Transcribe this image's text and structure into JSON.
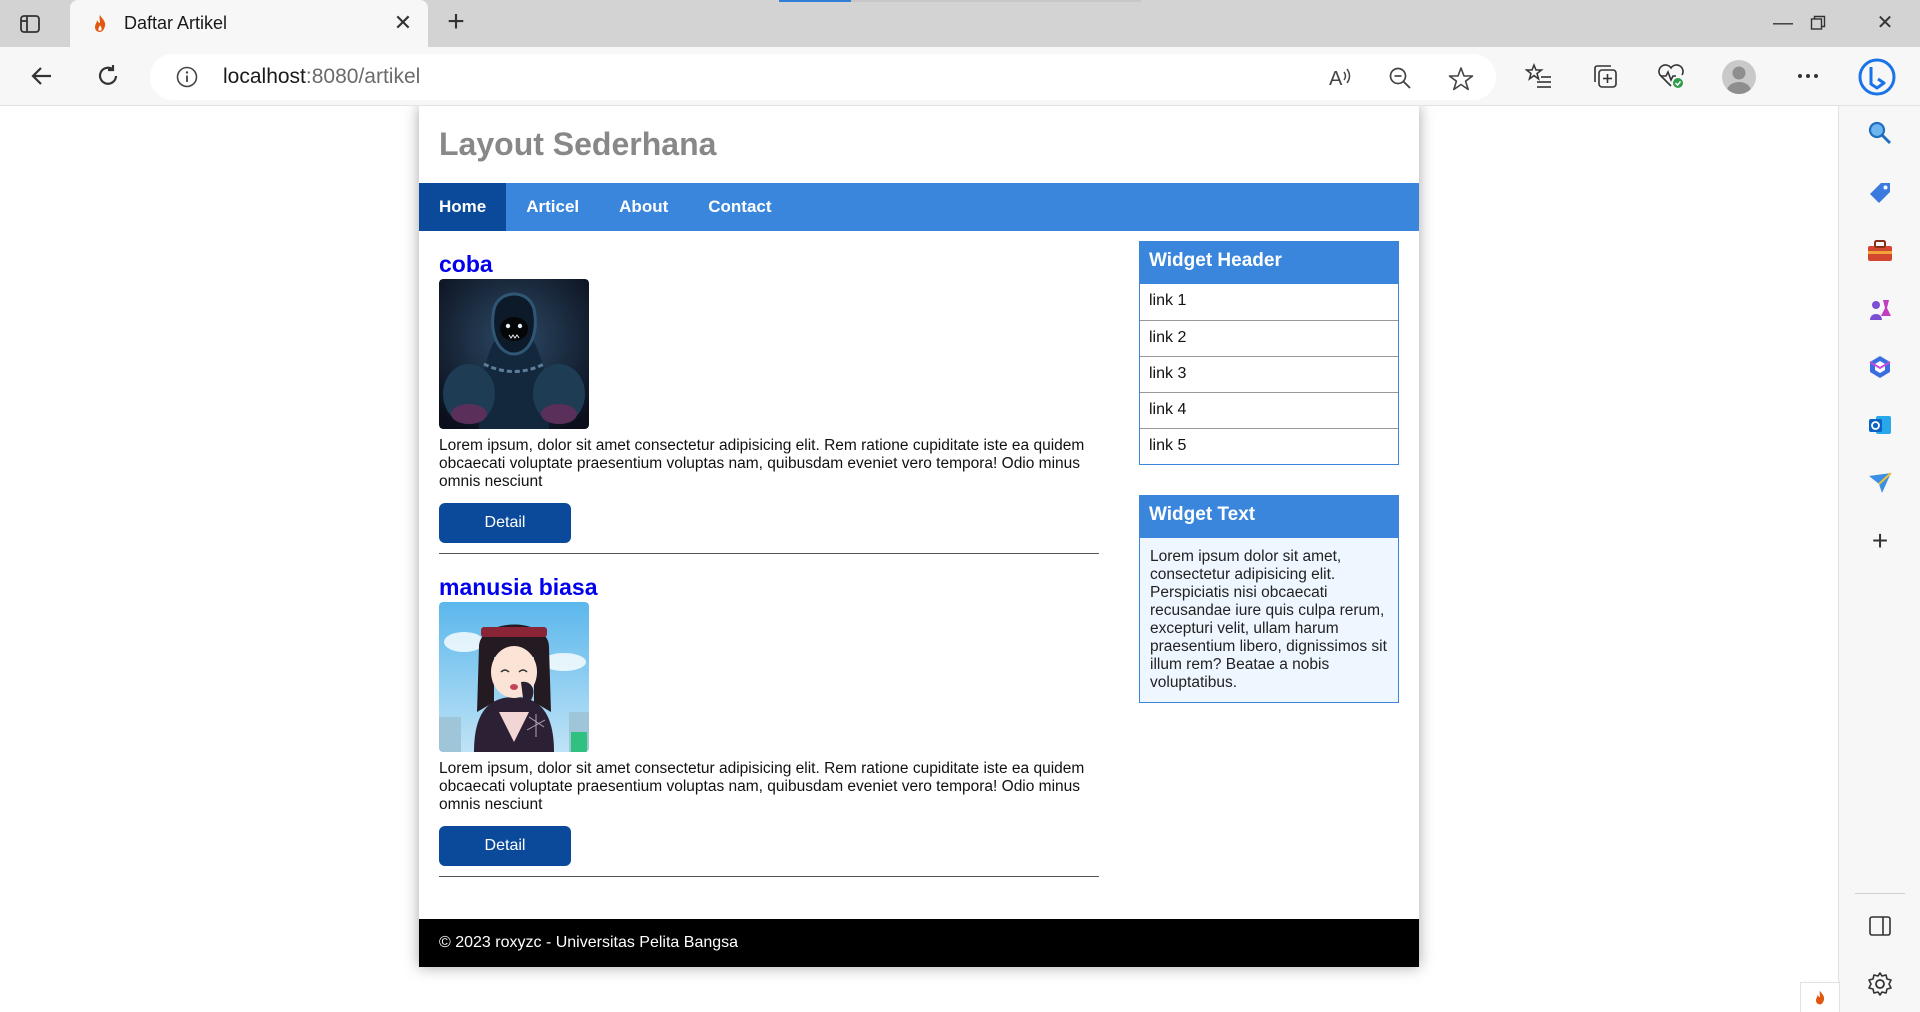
{
  "browser": {
    "tab_title": "Daftar Artikel",
    "url_host": "localhost",
    "url_rest": ":8080/artikel",
    "accent": "#2f7fd6"
  },
  "site": {
    "title": "Layout Sederhana",
    "nav": [
      "Home",
      "Articel",
      "About",
      "Contact"
    ],
    "nav_active": "Home",
    "nav_color": "#3a86dc",
    "nav_active_color": "#0b4a9a"
  },
  "articles": [
    {
      "title": "coba",
      "body": "Lorem ipsum, dolor sit amet consectetur adipisicing elit. Rem ratione cupiditate iste ea quidem obcaecati voluptate praesentium voluptas nam, quibusdam eveniet vero tempora! Odio minus omnis nesciunt",
      "button": "Detail"
    },
    {
      "title": "manusia biasa",
      "body": "Lorem ipsum, dolor sit amet consectetur adipisicing elit. Rem ratione cupiditate iste ea quidem obcaecati voluptate praesentium voluptas nam, quibusdam eveniet vero tempora! Odio minus omnis nesciunt",
      "button": "Detail"
    }
  ],
  "widgets": {
    "links_header": "Widget Header",
    "links": [
      "link 1",
      "link 2",
      "link 3",
      "link 4",
      "link 5"
    ],
    "text_header": "Widget Text",
    "text_body": "Lorem ipsum dolor sit amet, consectetur adipisicing elit. Perspiciatis nisi obcaecati recusandae iure quis culpa rerum, excepturi velit, ullam harum praesentium libero, dignissimos sit illum rem? Beatae a nobis voluptatibus."
  },
  "footer": "© 2023 roxyzc - Universitas Pelita Bangsa"
}
